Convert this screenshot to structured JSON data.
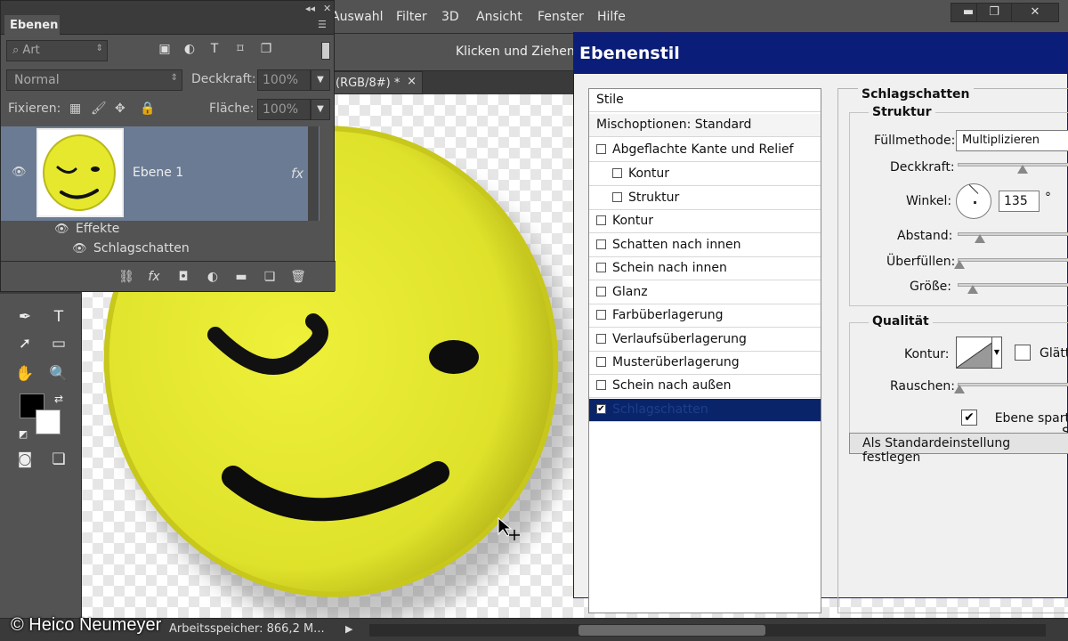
{
  "menubar": {
    "items": [
      "Auswahl",
      "Filter",
      "3D",
      "Ansicht",
      "Fenster",
      "Hilfe"
    ],
    "window_buttons": [
      "▬",
      "❐",
      "✕"
    ]
  },
  "options": {
    "hint": "Klicken und Ziehen"
  },
  "document_tab": {
    "label": "(RGB/8#) *",
    "close": "×"
  },
  "layers_panel": {
    "title": "Ebenen",
    "filter_placeholder": "Art",
    "blend_mode": "Normal",
    "opacity_label": "Deckkraft:",
    "opacity_value": "100%",
    "lock_label": "Fixieren:",
    "fill_label": "Fläche:",
    "fill_value": "100%",
    "layer_name": "Ebene 1",
    "fx": "fx",
    "effects_label": "Effekte",
    "effect_item": "Schlagschatten"
  },
  "dialog": {
    "title": "Ebenenstil",
    "styles": [
      {
        "label": "Stile",
        "checkbox": false,
        "indent": false,
        "selected": false
      },
      {
        "label": "Mischoptionen: Standard",
        "checkbox": false,
        "indent": false,
        "selected": false
      },
      {
        "label": "Abgeflachte Kante und Relief",
        "checkbox": true,
        "checked": false,
        "indent": false,
        "selected": false
      },
      {
        "label": "Kontur",
        "checkbox": true,
        "checked": false,
        "indent": true,
        "selected": false
      },
      {
        "label": "Struktur",
        "checkbox": true,
        "checked": false,
        "indent": true,
        "selected": false
      },
      {
        "label": "Kontur",
        "checkbox": true,
        "checked": false,
        "indent": false,
        "selected": false
      },
      {
        "label": "Schatten nach innen",
        "checkbox": true,
        "checked": false,
        "indent": false,
        "selected": false
      },
      {
        "label": "Schein nach innen",
        "checkbox": true,
        "checked": false,
        "indent": false,
        "selected": false
      },
      {
        "label": "Glanz",
        "checkbox": true,
        "checked": false,
        "indent": false,
        "selected": false
      },
      {
        "label": "Farbüberlagerung",
        "checkbox": true,
        "checked": false,
        "indent": false,
        "selected": false
      },
      {
        "label": "Verlaufsüberlagerung",
        "checkbox": true,
        "checked": false,
        "indent": false,
        "selected": false
      },
      {
        "label": "Musterüberlagerung",
        "checkbox": true,
        "checked": false,
        "indent": false,
        "selected": false
      },
      {
        "label": "Schein nach außen",
        "checkbox": true,
        "checked": false,
        "indent": false,
        "selected": false
      },
      {
        "label": "Schlagschatten",
        "checkbox": true,
        "checked": true,
        "indent": false,
        "selected": true
      }
    ],
    "section_title": "Schlagschatten",
    "structure": {
      "title": "Struktur",
      "blend_label": "Füllmethode:",
      "blend_value": "Multiplizieren",
      "opacity_label": "Deckkraft:",
      "angle_label": "Winkel:",
      "angle_value": "135",
      "degree": "°",
      "distance_label": "Abstand:",
      "spread_label": "Überfüllen:",
      "size_label": "Größe:"
    },
    "quality": {
      "title": "Qualität",
      "contour_label": "Kontur:",
      "antialias_label": "Glätt",
      "noise_label": "Rauschen:"
    },
    "knockout_label": "Ebene spart S",
    "default_button": "Als Standardeinstellung festlegen"
  },
  "statusbar": {
    "memory": "Arbeitsspeicher: 866,2 M...",
    "copyright": "© Heico Neumeyer"
  },
  "colors": {
    "smiley_yellow": "#e8ea2c",
    "dialog_title": "#0a1d78",
    "selection": "#0a246a",
    "layer_selected": "#6b7b93"
  }
}
